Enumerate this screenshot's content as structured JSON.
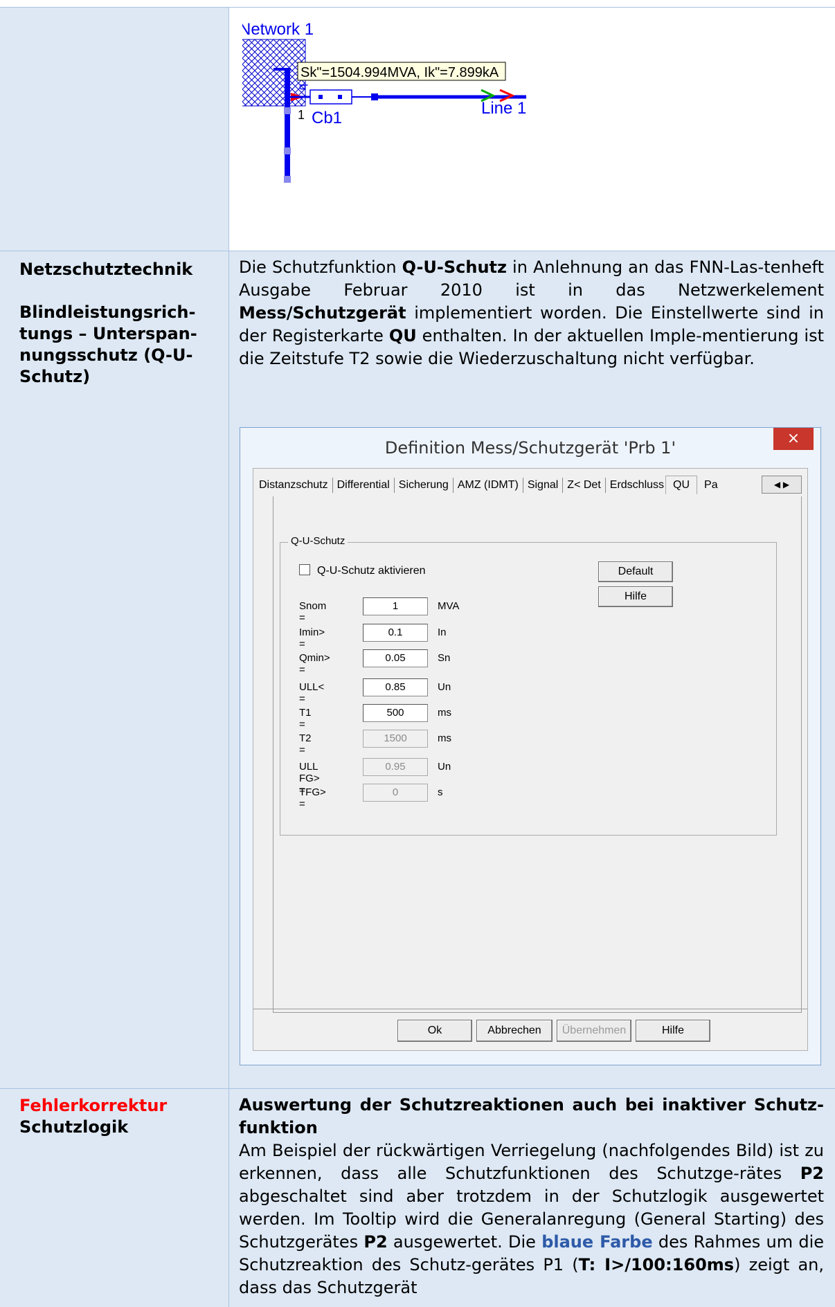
{
  "diagram": {
    "network_label": "Network 1",
    "tooltip": "Sk\"=1504.994MVA, Ik\"=7.899kA",
    "q_label": "q",
    "node_label": "1",
    "cb_label": "Cb1",
    "line_label": "Line 1"
  },
  "row2": {
    "left_title": "Netzschutztechnik",
    "left_sub_1": "Blindleistungsrich-",
    "left_sub_2": "tungs – Unterspan-",
    "left_sub_3": "nungsschutz (Q-U-",
    "left_sub_4": "Schutz)",
    "p_1": "Die Schutzfunktion ",
    "p_bold_1": "Q-U-Schutz",
    "p_2": " in Anlehnung an das FNN-Las-tenheft Ausgabe Februar 2010 ist in das Netzwerkelement ",
    "p_bold_2": "Mess/Schutzgerät",
    "p_3": " implementiert worden. Die Einstellwerte sind in der Registerkarte ",
    "p_bold_3": "QU",
    "p_4": " enthalten. In der aktuellen Imple-mentierung ist die Zeitstufe T2 sowie die Wiederzuschaltung nicht verfügbar."
  },
  "dialog": {
    "title": "Definition Mess/Schutzgerät 'Prb 1'",
    "close": "×",
    "tabs": [
      "Distanzschutz",
      "Differential",
      "Sicherung",
      "AMZ (IDMT)",
      "Signal",
      "Z< Det",
      "Erdschluss",
      "QU",
      "Pa"
    ],
    "active_tab": "QU",
    "group_title": "Q-U-Schutz",
    "checkbox_label": "Q-U-Schutz aktivieren",
    "default_btn": "Default",
    "help_btn": "Hilfe",
    "fields": [
      {
        "label": "Snom =",
        "value": "1",
        "unit": "MVA",
        "enabled": true
      },
      {
        "label": "Imin> =",
        "value": "0.1",
        "unit": "In",
        "enabled": true
      },
      {
        "label": "Qmin> =",
        "value": "0.05",
        "unit": "Sn",
        "enabled": true
      },
      {
        "label": "ULL< =",
        "value": "0.85",
        "unit": "Un",
        "enabled": true
      },
      {
        "label": "T1 =",
        "value": "500",
        "unit": "ms",
        "enabled": true
      },
      {
        "label": "T2 =",
        "value": "1500",
        "unit": "ms",
        "enabled": false
      },
      {
        "label": "ULL FG> =",
        "value": "0.95",
        "unit": "Un",
        "enabled": false
      },
      {
        "label": "TFG> =",
        "value": "0",
        "unit": "s",
        "enabled": false
      }
    ],
    "ok_btn": "Ok",
    "cancel_btn": "Abbrechen",
    "apply_btn": "Übernehmen",
    "help_btn2": "Hilfe"
  },
  "row3": {
    "left_title_red": "Fehlerkorrektur",
    "left_title": "Schutzlogik",
    "heading": "Auswertung der Schutzreaktionen auch bei inaktiver Schutz-funktion",
    "p_1": "Am Beispiel der rückwärtigen Verriegelung (nachfolgendes Bild) ist zu erkennen, dass alle Schutzfunktionen des Schutzge-rätes ",
    "p_bold_1": "P2",
    "p_2": " abgeschaltet sind aber trotzdem in der Schutzlogik ausgewertet werden. Im Tooltip wird die Generalanregung (General Starting) des Schutzgerätes ",
    "p_bold_2": "P2",
    "p_3": " ausgewertet. Die ",
    "p_blue": "blaue Farbe",
    "p_4": " des Rahmes um die Schutzreaktion des Schutz-gerätes P1 (",
    "p_bold_3": "T: I>/100:160ms",
    "p_5": ") zeigt an, dass das Schutzgerät"
  }
}
